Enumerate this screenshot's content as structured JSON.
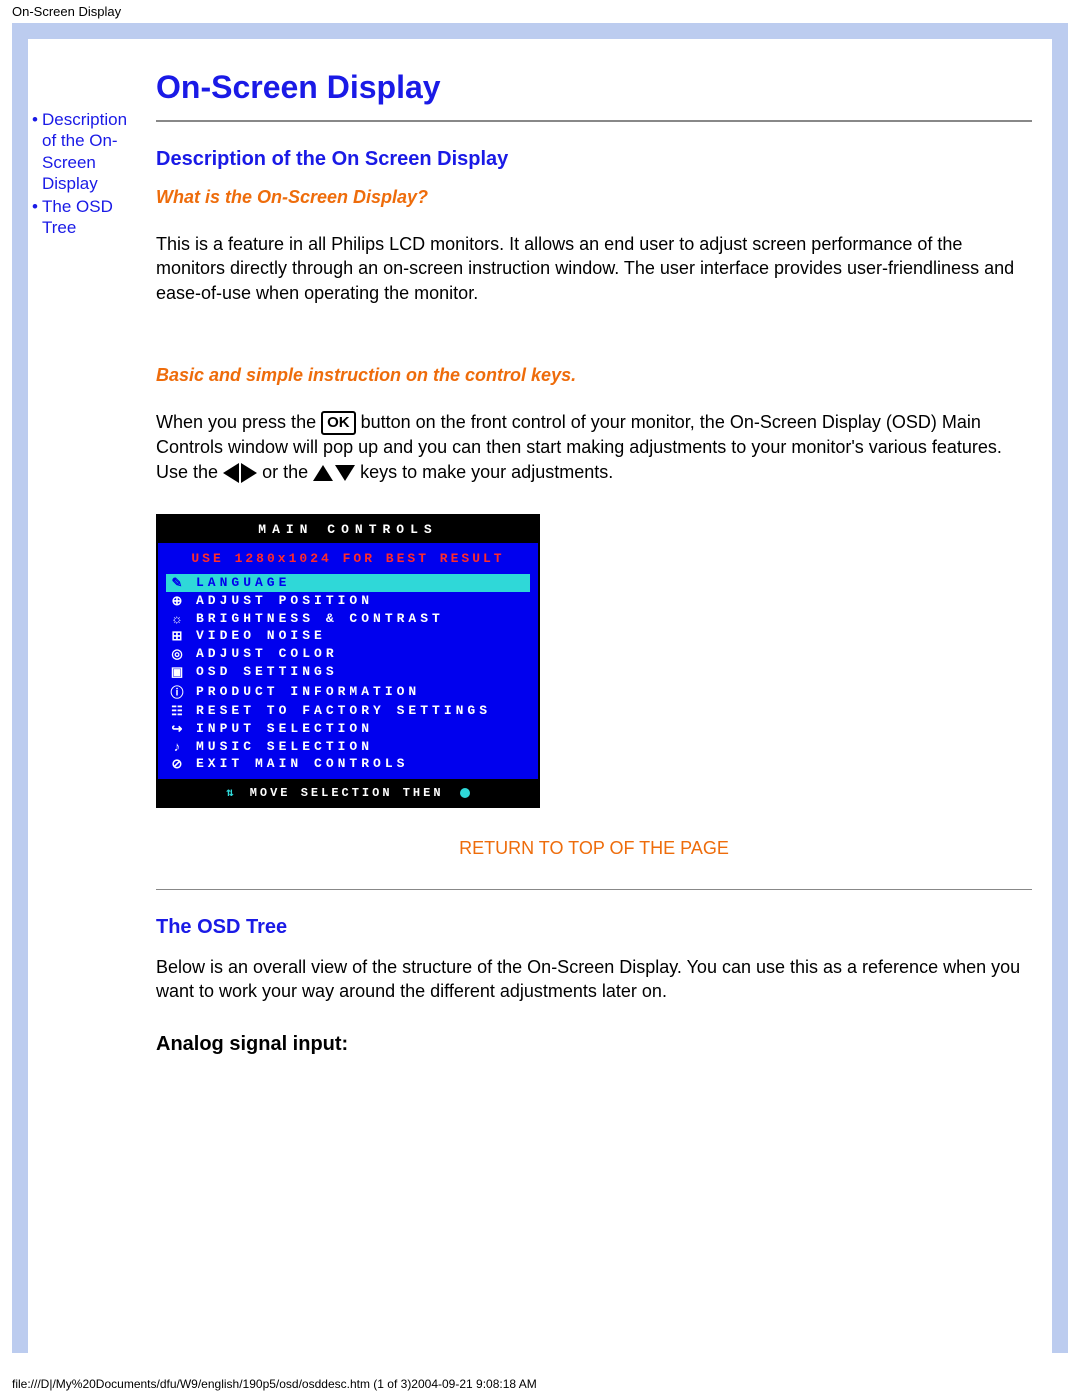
{
  "header_label": "On-Screen Display",
  "sidebar": {
    "items": [
      {
        "label": "Description of the On-Screen Display"
      },
      {
        "label": "The OSD Tree"
      }
    ]
  },
  "page_title": "On-Screen Display",
  "section1": {
    "heading": "Description of the On Screen Display",
    "q1": "What is the On-Screen Display?",
    "p1": "This is a feature in all Philips LCD monitors. It allows an end user to adjust screen performance of the monitors directly through an on-screen instruction window. The user interface provides user-friendliness and ease-of-use when operating the monitor.",
    "q2": "Basic and simple instruction on the control keys.",
    "p2_a": "When you press the ",
    "p2_ok": "OK",
    "p2_b": " button on the front control of your monitor, the On-Screen Display (OSD) Main Controls window will pop up and you can then start making adjustments to your monitor's various features. Use the ",
    "p2_c": " or the ",
    "p2_d": " keys to make your adjustments."
  },
  "osd": {
    "title": "MAIN CONTROLS",
    "warn": "USE 1280x1024 FOR BEST RESULT",
    "items": [
      {
        "icon": "✎",
        "label": "LANGUAGE",
        "selected": true
      },
      {
        "icon": "⊕",
        "label": "ADJUST POSITION"
      },
      {
        "icon": "☼",
        "label": "BRIGHTNESS & CONTRAST"
      },
      {
        "icon": "⊞",
        "label": "VIDEO NOISE"
      },
      {
        "icon": "◎",
        "label": "ADJUST COLOR"
      },
      {
        "icon": "▣",
        "label": "OSD SETTINGS"
      },
      {
        "icon": "ⓘ",
        "label": "PRODUCT INFORMATION"
      },
      {
        "icon": "☷",
        "label": "RESET TO FACTORY SETTINGS"
      },
      {
        "icon": "↪",
        "label": "INPUT SELECTION"
      },
      {
        "icon": "♪",
        "label": "MUSIC SELECTION"
      },
      {
        "icon": "⊘",
        "label": "EXIT MAIN CONTROLS"
      }
    ],
    "footer_icon": "⇅",
    "footer": "MOVE SELECTION THEN"
  },
  "return_link": "RETURN TO TOP OF THE PAGE",
  "section2": {
    "heading": "The OSD Tree",
    "p1": "Below is an overall view of the structure of the On-Screen Display. You can use this as a reference when you want to work your way around the different adjustments later on.",
    "sub": "Analog signal input:"
  },
  "footer_path": "file:///D|/My%20Documents/dfu/W9/english/190p5/osd/osddesc.htm (1 of 3)2004-09-21 9:08:18 AM"
}
